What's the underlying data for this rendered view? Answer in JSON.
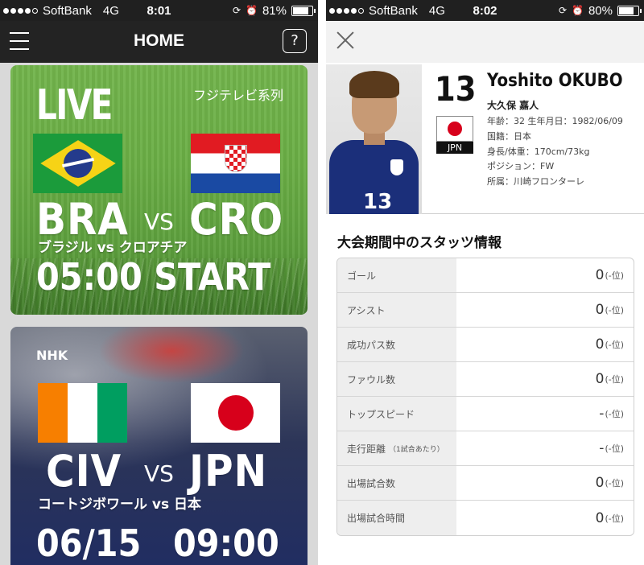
{
  "left": {
    "status": {
      "carrier": "SoftBank",
      "network": "4G",
      "time": "8:01",
      "battery": "81%",
      "battery_level": 0.81
    },
    "nav": {
      "title": "HOME",
      "help": "?"
    },
    "matches": [
      {
        "label": "LIVE",
        "channel": "フジテレビ系列",
        "home_code": "BRA",
        "away_code": "CRO",
        "vs": "VS",
        "jp_title": "ブラジル vs クロアチア",
        "start": "05:00 START"
      },
      {
        "channel": "NHK",
        "home_code": "CIV",
        "away_code": "JPN",
        "vs": "VS",
        "jp_title": "コートジボワール vs 日本",
        "date": "06/15",
        "time": "09:00"
      }
    ]
  },
  "right": {
    "status": {
      "carrier": "SoftBank",
      "network": "4G",
      "time": "8:02",
      "battery": "80%",
      "battery_level": 0.8
    },
    "player": {
      "number": "13",
      "name": "Yoshito OKUBO",
      "name_jp": "大久保 嘉人",
      "country_code": "JPN",
      "age_line": "年齢：32 生年月日：1982/06/09",
      "nationality": "国籍：日本",
      "body": "身長/体重：170cm/73kg",
      "position": "ポジション：FW",
      "club": "所属：川崎フロンターレ",
      "shirt_number": "13"
    },
    "stats_title": "大会期間中のスタッツ情報",
    "stats": [
      {
        "label": "ゴール",
        "note": "",
        "value": "0",
        "rank": "(-位)"
      },
      {
        "label": "アシスト",
        "note": "",
        "value": "0",
        "rank": "(-位)"
      },
      {
        "label": "成功パス数",
        "note": "",
        "value": "0",
        "rank": "(-位)"
      },
      {
        "label": "ファウル数",
        "note": "",
        "value": "0",
        "rank": "(-位)"
      },
      {
        "label": "トップスピード",
        "note": "",
        "value": "-",
        "rank": "(-位)"
      },
      {
        "label": "走行距離",
        "note": "（1試合あたり）",
        "value": "-",
        "rank": "(-位)"
      },
      {
        "label": "出場試合数",
        "note": "",
        "value": "0",
        "rank": "(-位)"
      },
      {
        "label": "出場試合時間",
        "note": "",
        "value": "0",
        "rank": "(-位)"
      }
    ]
  },
  "colors": {
    "brand_dark": "#232323",
    "japan_red": "#d7001b",
    "pitch_green": "#6aae45"
  }
}
